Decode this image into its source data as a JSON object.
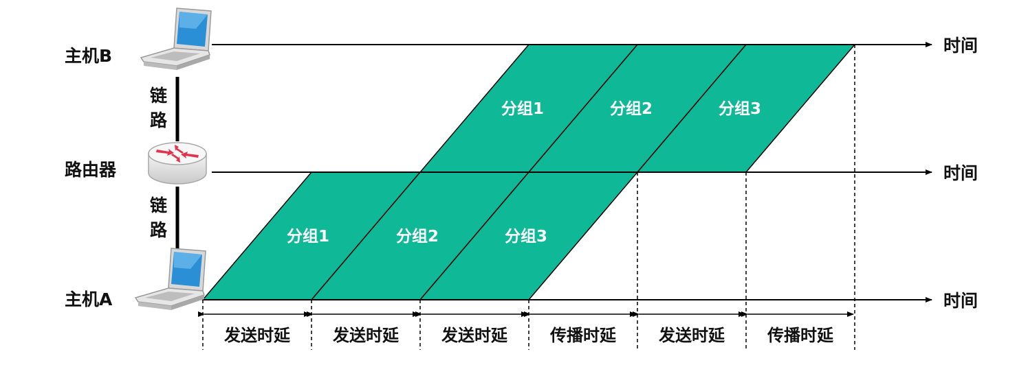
{
  "nodes": {
    "host_b": "主机B",
    "router": "路由器",
    "host_a": "主机A"
  },
  "links": {
    "upper": [
      "链",
      "路"
    ],
    "lower": [
      "链",
      "路"
    ]
  },
  "time_labels": [
    "时间",
    "时间",
    "时间"
  ],
  "packets_upper": [
    "分组1",
    "分组2",
    "分组3"
  ],
  "packets_lower": [
    "分组1",
    "分组2",
    "分组3"
  ],
  "segments": [
    "发送时延",
    "发送时延",
    "发送时延",
    "传播时延",
    "发送时延",
    "传播时延"
  ],
  "colors": {
    "packet_fill": "#0fb896",
    "line": "#000000",
    "text": "#111111",
    "laptop_screen": "#2b8fd6",
    "router_arrow": "#e0344a"
  },
  "icons": [
    "laptop-icon",
    "router-icon",
    "laptop-icon"
  ]
}
